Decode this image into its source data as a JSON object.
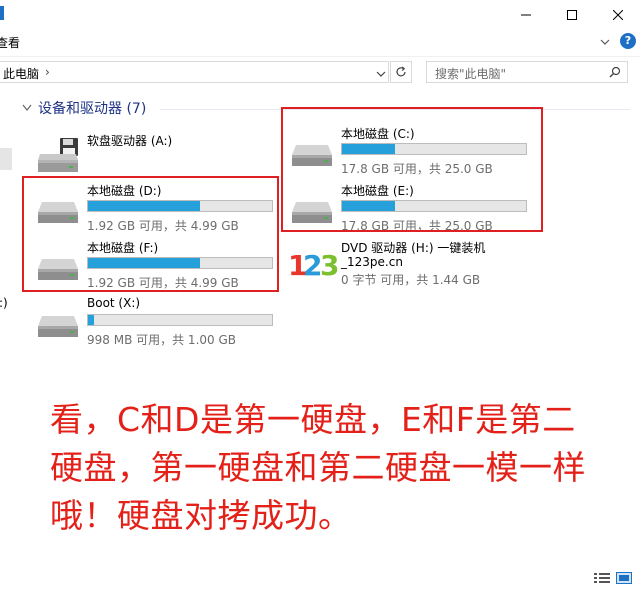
{
  "window": {
    "minimize_glyph": "minimize-icon",
    "maximize_glyph": "maximize-icon",
    "close_glyph": "close-icon"
  },
  "ribbon": {
    "tab_fragment": "查看",
    "help": "?"
  },
  "address": {
    "location": "此电脑",
    "separator": "›"
  },
  "search": {
    "placeholder": "搜索\"此电脑\""
  },
  "nav": {
    "fragment": ":)"
  },
  "group": {
    "label": "设备和驱动器 (7)"
  },
  "drives": [
    {
      "id": "A",
      "name": "软盘驱动器 (A:)",
      "info": "",
      "fill": null,
      "icon": "floppy-drive-icon"
    },
    {
      "id": "C",
      "name": "本地磁盘 (C:)",
      "info": "17.8 GB 可用，共 25.0 GB",
      "fill": 0.29,
      "icon": "hard-drive-icon"
    },
    {
      "id": "D",
      "name": "本地磁盘 (D:)",
      "info": "1.92 GB 可用，共 4.99 GB",
      "fill": 0.61,
      "icon": "hard-drive-icon"
    },
    {
      "id": "E",
      "name": "本地磁盘 (E:)",
      "info": "17.8 GB 可用，共 25.0 GB",
      "fill": 0.29,
      "icon": "hard-drive-icon"
    },
    {
      "id": "F",
      "name": "本地磁盘 (F:)",
      "info": "1.92 GB 可用，共 4.99 GB",
      "fill": 0.61,
      "icon": "hard-drive-icon"
    },
    {
      "id": "X",
      "name": "Boot (X:)",
      "info": "998 MB 可用，共 1.00 GB",
      "fill": 0.03,
      "icon": "hard-drive-icon"
    }
  ],
  "dvd": {
    "name": "DVD 驱动器 (H:) 一键装机",
    "label": "_123pe.cn",
    "info": "0 字节 可用，共 1.44 GB",
    "logo_digits": [
      "1",
      "2",
      "3"
    ],
    "logo_colors": [
      "#e8372a",
      "#2a9bd8",
      "#7cbf2f"
    ]
  },
  "annotation": {
    "text": "看，C和D是第一硬盘，E和F是第二硬盘，第一硬盘和第二硬盘一模一样哦！硬盘对拷成功。",
    "color": "#e32119"
  },
  "colors": {
    "accent": "#1e70c7",
    "bar_fill": "#26a0da",
    "highlight_border": "#e02020"
  }
}
